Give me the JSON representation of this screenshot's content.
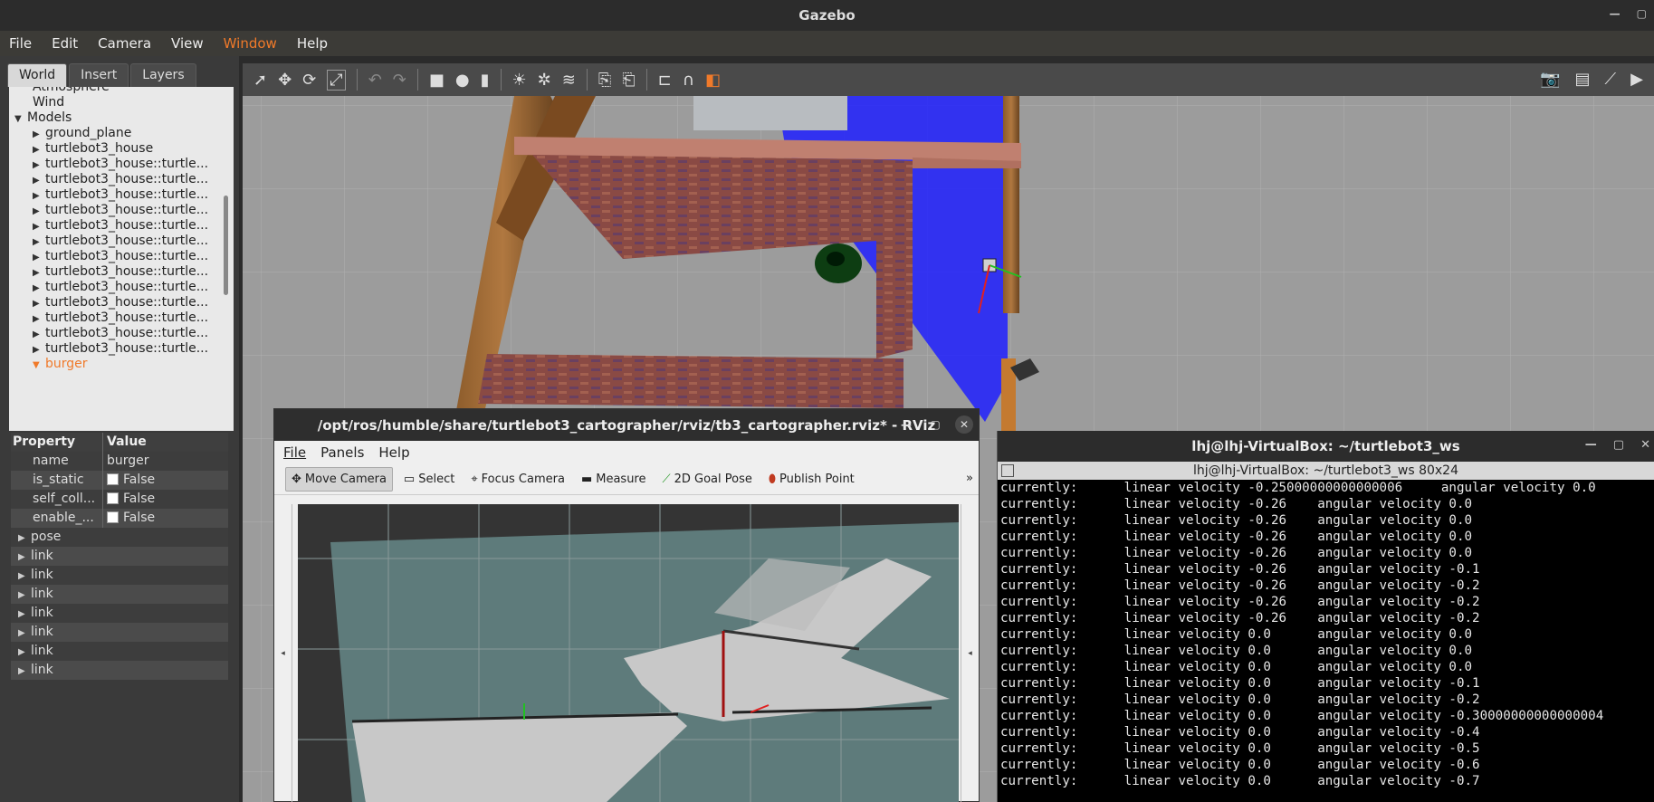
{
  "window": {
    "title": "Gazebo",
    "buttons": [
      "—",
      "▢"
    ]
  },
  "menu": [
    "File",
    "Edit",
    "Camera",
    "View",
    "Window",
    "Help"
  ],
  "left_panel": {
    "tabs": [
      "World",
      "Insert",
      "Layers"
    ],
    "tree": {
      "top_cut": "Atmosphere",
      "wind": "Wind",
      "models_label": "Models",
      "items": [
        "ground_plane",
        "turtlebot3_house",
        "turtlebot3_house::turtle...",
        "turtlebot3_house::turtle...",
        "turtlebot3_house::turtle...",
        "turtlebot3_house::turtle...",
        "turtlebot3_house::turtle...",
        "turtlebot3_house::turtle...",
        "turtlebot3_house::turtle...",
        "turtlebot3_house::turtle...",
        "turtlebot3_house::turtle...",
        "turtlebot3_house::turtle...",
        "turtlebot3_house::turtle...",
        "turtlebot3_house::turtle...",
        "turtlebot3_house::turtle..."
      ],
      "selected": "burger"
    },
    "properties": {
      "header": {
        "property": "Property",
        "value": "Value"
      },
      "rows": [
        {
          "name": "name",
          "value": "burger",
          "checkbox": false
        },
        {
          "name": "is_static",
          "value": "False",
          "checkbox": true
        },
        {
          "name": "self_coll...",
          "value": "False",
          "checkbox": true
        },
        {
          "name": "enable_...",
          "value": "False",
          "checkbox": true
        }
      ],
      "sections": [
        "pose",
        "link",
        "link",
        "link",
        "link",
        "link",
        "link",
        "link"
      ]
    }
  },
  "rviz": {
    "title": "/opt/ros/humble/share/turtlebot3_cartographer/rviz/tb3_cartographer.rviz* - RViz",
    "menu": [
      "File",
      "Panels",
      "Help"
    ],
    "tools": [
      "Move Camera",
      "Select",
      "Focus Camera",
      "Measure",
      "2D Goal Pose",
      "Publish Point"
    ],
    "more": "»"
  },
  "terminal": {
    "title": "lhj@lhj-VirtualBox: ~/turtlebot3_ws",
    "subtitle": "lhj@lhj-VirtualBox: ~/turtlebot3_ws 80x24",
    "lines": [
      "currently:      linear velocity -0.25000000000000006     angular velocity 0.0",
      "currently:      linear velocity -0.26    angular velocity 0.0",
      "currently:      linear velocity -0.26    angular velocity 0.0",
      "currently:      linear velocity -0.26    angular velocity 0.0",
      "currently:      linear velocity -0.26    angular velocity 0.0",
      "currently:      linear velocity -0.26    angular velocity -0.1",
      "currently:      linear velocity -0.26    angular velocity -0.2",
      "currently:      linear velocity -0.26    angular velocity -0.2",
      "currently:      linear velocity -0.26    angular velocity -0.2",
      "currently:      linear velocity 0.0      angular velocity 0.0",
      "currently:      linear velocity 0.0      angular velocity 0.0",
      "currently:      linear velocity 0.0      angular velocity 0.0",
      "currently:      linear velocity 0.0      angular velocity -0.1",
      "currently:      linear velocity 0.0      angular velocity -0.2",
      "currently:      linear velocity 0.0      angular velocity -0.30000000000000004",
      "currently:      linear velocity 0.0      angular velocity -0.4",
      "currently:      linear velocity 0.0      angular velocity -0.5",
      "currently:      linear velocity 0.0      angular velocity -0.6",
      "currently:      linear velocity 0.0      angular velocity -0.7"
    ]
  },
  "colors": {
    "accent": "#f07a2a",
    "laser": "#1f1fff"
  }
}
